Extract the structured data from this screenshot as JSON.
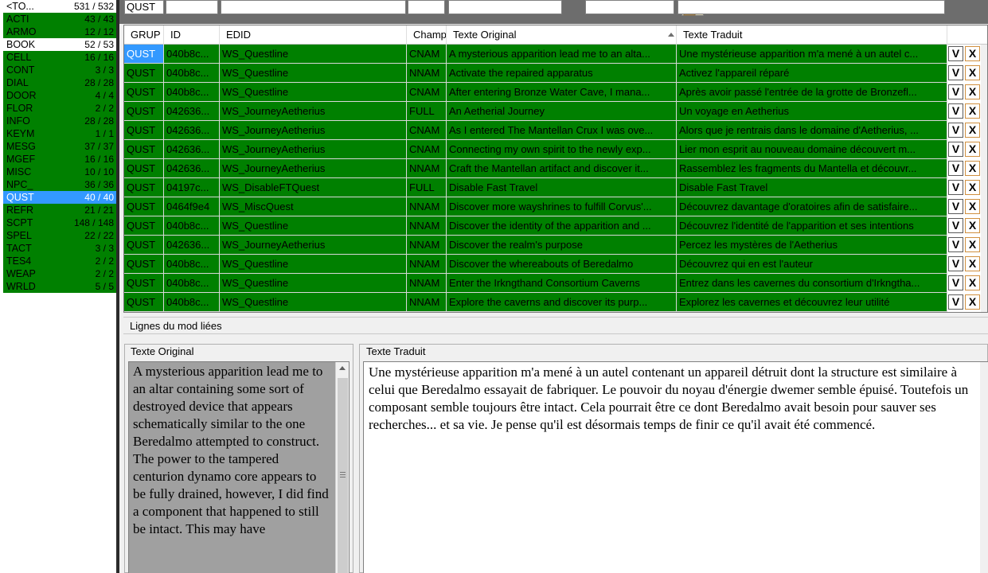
{
  "categories": [
    {
      "name": "<TO...",
      "count": "531 / 532",
      "style": "white"
    },
    {
      "name": "ACTI",
      "count": "43 / 43",
      "style": "green"
    },
    {
      "name": "ARMO",
      "count": "12 / 12",
      "style": "green"
    },
    {
      "name": "BOOK",
      "count": "52 / 53",
      "style": "white"
    },
    {
      "name": "CELL",
      "count": "16 / 16",
      "style": "green"
    },
    {
      "name": "CONT",
      "count": "3 / 3",
      "style": "green"
    },
    {
      "name": "DIAL",
      "count": "28 / 28",
      "style": "green"
    },
    {
      "name": "DOOR",
      "count": "4 / 4",
      "style": "green"
    },
    {
      "name": "FLOR",
      "count": "2 / 2",
      "style": "green"
    },
    {
      "name": "INFO",
      "count": "28 / 28",
      "style": "green"
    },
    {
      "name": "KEYM",
      "count": "1 / 1",
      "style": "green"
    },
    {
      "name": "MESG",
      "count": "37 / 37",
      "style": "green"
    },
    {
      "name": "MGEF",
      "count": "16 / 16",
      "style": "green"
    },
    {
      "name": "MISC",
      "count": "10 / 10",
      "style": "green"
    },
    {
      "name": "NPC_",
      "count": "36 / 36",
      "style": "green"
    },
    {
      "name": "QUST",
      "count": "40 / 40",
      "style": "selected"
    },
    {
      "name": "REFR",
      "count": "21 / 21",
      "style": "green"
    },
    {
      "name": "SCPT",
      "count": "148 / 148",
      "style": "green"
    },
    {
      "name": "SPEL",
      "count": "22 / 22",
      "style": "green"
    },
    {
      "name": "TACT",
      "count": "3 / 3",
      "style": "green"
    },
    {
      "name": "TES4",
      "count": "2 / 2",
      "style": "green"
    },
    {
      "name": "WEAP",
      "count": "2 / 2",
      "style": "green"
    },
    {
      "name": "WRLD",
      "count": "5 / 5",
      "style": "green"
    }
  ],
  "filters": {
    "grup": "QUST",
    "id": "",
    "edid": "",
    "champ": "",
    "texte_original": "",
    "texte_traduit": ""
  },
  "grid": {
    "headers": {
      "grup": "GRUP",
      "id": "ID",
      "edid": "EDID",
      "champ": "Champ",
      "texte_original": "Texte Original",
      "texte_traduit": "Texte Traduit"
    },
    "validate_label": "V",
    "delete_label": "X",
    "rows": [
      {
        "grup": "QUST",
        "id": "040b8c...",
        "edid": "WS_Questline",
        "champ": "CNAM",
        "orig": "A mysterious apparition lead me to an alta...",
        "trad": "Une mystérieuse apparition m'a mené à un autel c..."
      },
      {
        "grup": "QUST",
        "id": "040b8c...",
        "edid": "WS_Questline",
        "champ": "NNAM",
        "orig": "Activate the repaired apparatus",
        "trad": "Activez l'appareil réparé"
      },
      {
        "grup": "QUST",
        "id": "040b8c...",
        "edid": "WS_Questline",
        "champ": "CNAM",
        "orig": "After entering Bronze Water Cave, I mana...",
        "trad": "Après avoir passé l'entrée de la grotte de Bronzefl..."
      },
      {
        "grup": "QUST",
        "id": "042636...",
        "edid": "WS_JourneyAetherius",
        "champ": "FULL",
        "orig": "An Aetherial Journey",
        "trad": "Un voyage en Aetherius"
      },
      {
        "grup": "QUST",
        "id": "042636...",
        "edid": "WS_JourneyAetherius",
        "champ": "CNAM",
        "orig": "As I entered The Mantellan Crux I was ove...",
        "trad": "Alors que je rentrais dans le domaine d'Aetherius, ..."
      },
      {
        "grup": "QUST",
        "id": "042636...",
        "edid": "WS_JourneyAetherius",
        "champ": "CNAM",
        "orig": "Connecting my own spirit to the newly exp...",
        "trad": "Lier mon esprit au nouveau domaine découvert m..."
      },
      {
        "grup": "QUST",
        "id": "042636...",
        "edid": "WS_JourneyAetherius",
        "champ": "NNAM",
        "orig": "Craft the Mantellan artifact and discover it...",
        "trad": "Rassemblez les fragments du Mantella et découvr..."
      },
      {
        "grup": "QUST",
        "id": "04197c...",
        "edid": "WS_DisableFTQuest",
        "champ": "FULL",
        "orig": "Disable Fast Travel",
        "trad": "Disable Fast Travel"
      },
      {
        "grup": "QUST",
        "id": "0464f9e4",
        "edid": "WS_MiscQuest",
        "champ": "NNAM",
        "orig": "Discover more wayshrines to fulfill Corvus'...",
        "trad": "Découvrez davantage d'oratoires afin de satisfaire..."
      },
      {
        "grup": "QUST",
        "id": "040b8c...",
        "edid": "WS_Questline",
        "champ": "NNAM",
        "orig": "Discover the identity of the apparition and ...",
        "trad": "Découvrez l'identité de l'apparition et ses intentions"
      },
      {
        "grup": "QUST",
        "id": "042636...",
        "edid": "WS_JourneyAetherius",
        "champ": "NNAM",
        "orig": "Discover the realm's purpose",
        "trad": "Percez les mystères de l'Aetherius"
      },
      {
        "grup": "QUST",
        "id": "040b8c...",
        "edid": "WS_Questline",
        "champ": "NNAM",
        "orig": "Discover the whereabouts of Beredalmo",
        "trad": "Découvrez qui en est l'auteur"
      },
      {
        "grup": "QUST",
        "id": "040b8c...",
        "edid": "WS_Questline",
        "champ": "NNAM",
        "orig": "Enter the Irkngthand Consortium Caverns",
        "trad": "Entrez dans les cavernes du consortium d'Irkngtha..."
      },
      {
        "grup": "QUST",
        "id": "040b8c...",
        "edid": "WS_Questline",
        "champ": "NNAM",
        "orig": "Explore the caverns and discover its purp...",
        "trad": "Explorez les cavernes et découvrez leur utilité"
      }
    ]
  },
  "linked_lines_label": "Lignes du mod liées",
  "original_panel": {
    "title": "Texte Original",
    "text": "A mysterious apparition lead me to an altar containing some sort of destroyed device that appears schematically similar to the one Beredalmo attempted to construct. The power to the tampered centurion dynamo core appears to be fully drained, however, I did find a component that happened to still be intact. This may have"
  },
  "translated_panel": {
    "title": "Texte Traduit",
    "text": "Une mystérieuse apparition m'a mené à un autel contenant un appareil détruit dont la structure est similaire à celui que Beredalmo essayait de fabriquer. Le pouvoir du noyau d'énergie dwemer semble épuisé. Toutefois un composant semble toujours être intact. Cela pourrait être ce dont Beredalmo avait besoin pour sauver ses recherches... et sa vie. Je pense qu'il est désormais temps de finir ce qu'il avait été commencé."
  },
  "colors": {
    "validated_row": "#008000",
    "selected": "#3399ff",
    "original_text_bg": "#a0a0a0"
  }
}
